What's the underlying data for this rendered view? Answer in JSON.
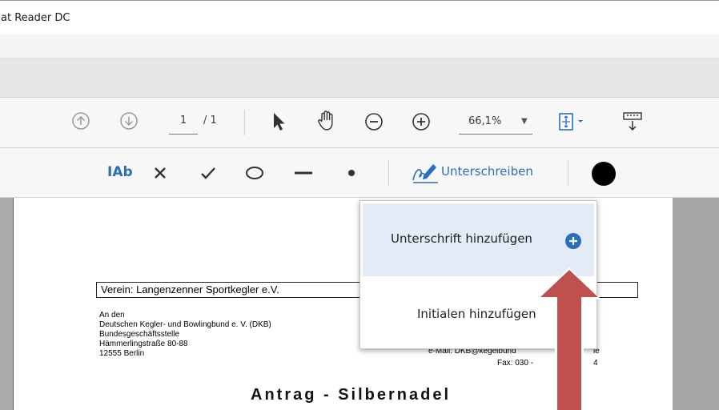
{
  "window": {
    "title": "at Reader DC"
  },
  "toolbar": {
    "page_current": "1",
    "page_total": "/ 1",
    "zoom_value": "66,1%",
    "zoom_caret": "▼"
  },
  "fill_sign": {
    "text_tool_label": "IAb",
    "sign_label": "Unterschreiben"
  },
  "dropdown": {
    "add_signature": "Unterschrift hinzufügen",
    "add_initials": "Initialen hinzufügen"
  },
  "document": {
    "verein": "Verein: Langenzenner Sportkegler e.V.",
    "address": [
      "An den",
      "Deutschen Kegler- und Bowlingbund e. V. (DKB)",
      "Bundesgeschäftsstelle",
      "Hämmerlingstraße 80-88",
      "12555 Berlin"
    ],
    "email": "e-Mail: DKB@kegelbund",
    "email_suffix": "le",
    "fax": "Fax: 030 -",
    "fax_suffix": "4",
    "heading": "Antrag - Silbernadel"
  },
  "colors": {
    "accent": "#2a6ebc",
    "arrow": "#c0504d",
    "highlight": "#e3ecf6"
  },
  "icons": [
    "page-up-icon",
    "page-down-icon",
    "select-arrow-icon",
    "hand-icon",
    "zoom-out-icon",
    "zoom-in-icon",
    "fit-page-icon",
    "scroll-mode-icon",
    "cross-icon",
    "check-icon",
    "circle-icon",
    "line-icon",
    "dot-icon",
    "signature-pen-icon",
    "color-swatch-icon",
    "plus-circle-icon"
  ]
}
